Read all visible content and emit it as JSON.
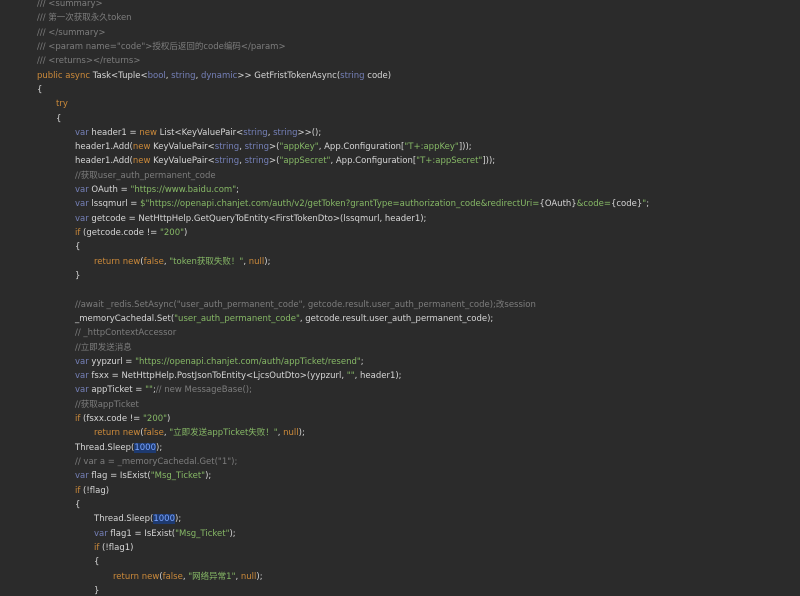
{
  "editor": {
    "language": "csharp",
    "theme": {
      "background": "#2b2b2b",
      "plain": "#d6d6d6",
      "comment": "#7d7d7d",
      "keyword": "#cc8a3a",
      "type": "#7580b8",
      "string": "#86b866",
      "number": "#7aa4ff",
      "number_highlight": "#1e3a70"
    }
  },
  "lines": [
    {
      "indent": 0,
      "tokens": [
        [
          "cm",
          "/// <summary>"
        ]
      ]
    },
    {
      "indent": 0,
      "tokens": [
        [
          "cm",
          "/// 第一次获取永久token"
        ]
      ]
    },
    {
      "indent": 0,
      "tokens": [
        [
          "cm",
          "/// </summary>"
        ]
      ]
    },
    {
      "indent": 0,
      "tokens": [
        [
          "cm",
          "/// <param name=\"code\">授权后返回的code编码</param>"
        ]
      ]
    },
    {
      "indent": 0,
      "tokens": [
        [
          "cm",
          "/// <returns></returns>"
        ]
      ]
    },
    {
      "indent": 0,
      "tokens": [
        [
          "kw",
          "public async"
        ],
        [
          "p",
          " Task<Tuple<"
        ],
        [
          "ty",
          "bool"
        ],
        [
          "p",
          ", "
        ],
        [
          "ty",
          "string"
        ],
        [
          "p",
          ", "
        ],
        [
          "ty",
          "dynamic"
        ],
        [
          "p",
          ">> GetFristTokenAsync("
        ],
        [
          "ty",
          "string"
        ],
        [
          "p",
          " code)"
        ]
      ]
    },
    {
      "indent": 0,
      "tokens": [
        [
          "p",
          "{"
        ]
      ]
    },
    {
      "indent": 1,
      "tokens": [
        [
          "kw",
          "try"
        ]
      ]
    },
    {
      "indent": 1,
      "tokens": [
        [
          "p",
          "{"
        ]
      ]
    },
    {
      "indent": 2,
      "tokens": [
        [
          "ty",
          "var"
        ],
        [
          "p",
          " header1 = "
        ],
        [
          "kw",
          "new"
        ],
        [
          "p",
          " List<KeyValuePair<"
        ],
        [
          "ty",
          "string"
        ],
        [
          "p",
          ", "
        ],
        [
          "ty",
          "string"
        ],
        [
          "p",
          ">>();"
        ]
      ]
    },
    {
      "indent": 2,
      "tokens": [
        [
          "p",
          "header1.Add("
        ],
        [
          "kw",
          "new"
        ],
        [
          "p",
          " KeyValuePair<"
        ],
        [
          "ty",
          "string"
        ],
        [
          "p",
          ", "
        ],
        [
          "ty",
          "string"
        ],
        [
          "p",
          ">("
        ],
        [
          "s",
          "\"appKey\""
        ],
        [
          "p",
          ", App.Configuration["
        ],
        [
          "s",
          "\"T+:appKey\""
        ],
        [
          "p",
          "]));"
        ]
      ]
    },
    {
      "indent": 2,
      "tokens": [
        [
          "p",
          "header1.Add("
        ],
        [
          "kw",
          "new"
        ],
        [
          "p",
          " KeyValuePair<"
        ],
        [
          "ty",
          "string"
        ],
        [
          "p",
          ", "
        ],
        [
          "ty",
          "string"
        ],
        [
          "p",
          ">("
        ],
        [
          "s",
          "\"appSecret\""
        ],
        [
          "p",
          ", App.Configuration["
        ],
        [
          "s",
          "\"T+:appSecret\""
        ],
        [
          "p",
          "]));"
        ]
      ]
    },
    {
      "indent": 2,
      "tokens": [
        [
          "cm",
          "//获取user_auth_permanent_code"
        ]
      ]
    },
    {
      "indent": 2,
      "tokens": [
        [
          "ty",
          "var"
        ],
        [
          "p",
          " OAuth = "
        ],
        [
          "s",
          "\"https://www.baidu.com\""
        ],
        [
          "p",
          ";"
        ]
      ]
    },
    {
      "indent": 2,
      "tokens": [
        [
          "ty",
          "var"
        ],
        [
          "p",
          " lssqmurl = "
        ],
        [
          "s",
          "$\"https://openapi.chanjet.com/auth/v2/getToken?grantType=authorization_code&redirectUri="
        ],
        [
          "p",
          "{OAuth}"
        ],
        [
          "s",
          "&code="
        ],
        [
          "p",
          "{code}"
        ],
        [
          "s",
          "\""
        ],
        [
          "p",
          ";"
        ]
      ]
    },
    {
      "indent": 2,
      "tokens": [
        [
          "ty",
          "var"
        ],
        [
          "p",
          " getcode = NetHttpHelp.GetQueryToEntity<FirstTokenDto>(lssqmurl, header1);"
        ]
      ]
    },
    {
      "indent": 2,
      "tokens": [
        [
          "kw",
          "if"
        ],
        [
          "p",
          " (getcode.code != "
        ],
        [
          "s",
          "\"200\""
        ],
        [
          "p",
          ")"
        ]
      ]
    },
    {
      "indent": 2,
      "tokens": [
        [
          "p",
          "{"
        ]
      ]
    },
    {
      "indent": 3,
      "tokens": [
        [
          "kw",
          "return"
        ],
        [
          "p",
          " "
        ],
        [
          "kw",
          "new"
        ],
        [
          "p",
          "("
        ],
        [
          "kw",
          "false"
        ],
        [
          "p",
          ", "
        ],
        [
          "s",
          "\"token获取失败！\""
        ],
        [
          "p",
          ", "
        ],
        [
          "kw",
          "null"
        ],
        [
          "p",
          ");"
        ]
      ]
    },
    {
      "indent": 2,
      "tokens": [
        [
          "p",
          "}"
        ]
      ]
    },
    {
      "indent": 2,
      "tokens": []
    },
    {
      "indent": 2,
      "tokens": [
        [
          "cm",
          "//await _redis.SetAsync(\"user_auth_permanent_code\", getcode.result.user_auth_permanent_code);改session"
        ]
      ]
    },
    {
      "indent": 2,
      "tokens": [
        [
          "p",
          "_memoryCachedal.Set("
        ],
        [
          "s",
          "\"user_auth_permanent_code\""
        ],
        [
          "p",
          ", getcode.result.user_auth_permanent_code);"
        ]
      ]
    },
    {
      "indent": 2,
      "tokens": [
        [
          "cm",
          "// _httpContextAccessor"
        ]
      ]
    },
    {
      "indent": 2,
      "tokens": [
        [
          "cm",
          "//立即发送消息"
        ]
      ]
    },
    {
      "indent": 2,
      "tokens": [
        [
          "ty",
          "var"
        ],
        [
          "p",
          " yypzurl = "
        ],
        [
          "s",
          "\"https://openapi.chanjet.com/auth/appTicket/resend\""
        ],
        [
          "p",
          ";"
        ]
      ]
    },
    {
      "indent": 2,
      "tokens": [
        [
          "ty",
          "var"
        ],
        [
          "p",
          " fsxx = NetHttpHelp.PostJsonToEntity<LjcsOutDto>(yypzurl, "
        ],
        [
          "s",
          "\"\""
        ],
        [
          "p",
          ", header1);"
        ]
      ]
    },
    {
      "indent": 2,
      "tokens": [
        [
          "ty",
          "var"
        ],
        [
          "p",
          " appTicket = "
        ],
        [
          "s",
          "\"\""
        ],
        [
          "p",
          ";"
        ],
        [
          "cm",
          "// new MessageBase();"
        ]
      ]
    },
    {
      "indent": 2,
      "tokens": [
        [
          "cm",
          "//获取appTicket"
        ]
      ]
    },
    {
      "indent": 2,
      "tokens": [
        [
          "kw",
          "if"
        ],
        [
          "p",
          " (fsxx.code != "
        ],
        [
          "s",
          "\"200\""
        ],
        [
          "p",
          ")"
        ]
      ]
    },
    {
      "indent": 3,
      "tokens": [
        [
          "kw",
          "return"
        ],
        [
          "p",
          " "
        ],
        [
          "kw",
          "new"
        ],
        [
          "p",
          "("
        ],
        [
          "kw",
          "false"
        ],
        [
          "p",
          ", "
        ],
        [
          "s",
          "\"立即发送appTicket失败！\""
        ],
        [
          "p",
          ", "
        ],
        [
          "kw",
          "null"
        ],
        [
          "p",
          ");"
        ]
      ]
    },
    {
      "indent": 2,
      "tokens": [
        [
          "p",
          "Thread.Sleep("
        ],
        [
          "num",
          "1000"
        ],
        [
          "p",
          ");"
        ]
      ]
    },
    {
      "indent": 2,
      "tokens": [
        [
          "cm",
          "// var a = _memoryCachedal.Get(\"1\");"
        ]
      ]
    },
    {
      "indent": 2,
      "tokens": [
        [
          "ty",
          "var"
        ],
        [
          "p",
          " flag = IsExist("
        ],
        [
          "s",
          "\"Msg_Ticket\""
        ],
        [
          "p",
          ");"
        ]
      ]
    },
    {
      "indent": 2,
      "tokens": [
        [
          "kw",
          "if"
        ],
        [
          "p",
          " (!flag)"
        ]
      ]
    },
    {
      "indent": 2,
      "tokens": [
        [
          "p",
          "{"
        ]
      ]
    },
    {
      "indent": 3,
      "tokens": [
        [
          "p",
          "Thread.Sleep("
        ],
        [
          "num",
          "1000"
        ],
        [
          "p",
          ");"
        ]
      ]
    },
    {
      "indent": 3,
      "tokens": [
        [
          "ty",
          "var"
        ],
        [
          "p",
          " flag1 = IsExist("
        ],
        [
          "s",
          "\"Msg_Ticket\""
        ],
        [
          "p",
          ");"
        ]
      ]
    },
    {
      "indent": 3,
      "tokens": [
        [
          "kw",
          "if"
        ],
        [
          "p",
          " (!flag1)"
        ]
      ]
    },
    {
      "indent": 3,
      "tokens": [
        [
          "p",
          "{"
        ]
      ]
    },
    {
      "indent": 4,
      "tokens": [
        [
          "kw",
          "return"
        ],
        [
          "p",
          " "
        ],
        [
          "kw",
          "new"
        ],
        [
          "p",
          "("
        ],
        [
          "kw",
          "false"
        ],
        [
          "p",
          ", "
        ],
        [
          "s",
          "\"网络异常1\""
        ],
        [
          "p",
          ", "
        ],
        [
          "kw",
          "null"
        ],
        [
          "p",
          ");"
        ]
      ]
    },
    {
      "indent": 3,
      "tokens": [
        [
          "p",
          "}"
        ]
      ]
    }
  ]
}
